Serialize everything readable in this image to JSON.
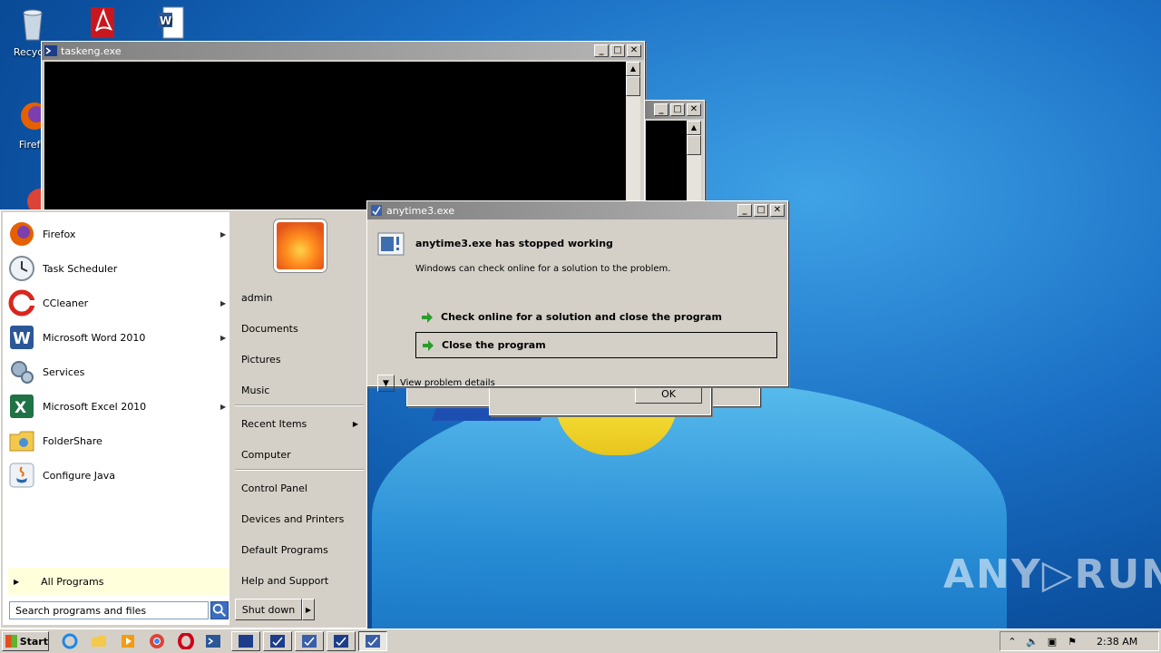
{
  "desktop": {
    "icons": [
      {
        "label": "Recycle"
      },
      {
        "label": "Firefo"
      }
    ]
  },
  "windows": {
    "taskeng": {
      "title": "taskeng.exe"
    },
    "error": {
      "title": "anytime3.exe",
      "heading": "anytime3.exe has stopped working",
      "subtext": "Windows can check online for a solution to the problem.",
      "option_check": "Check online for a solution and close the program",
      "option_close": "Close the program",
      "details": "View problem details"
    },
    "background_ok": "OK"
  },
  "start_menu": {
    "programs": [
      {
        "label": "Firefox",
        "submenu": true,
        "icon": "firefox-icon"
      },
      {
        "label": "Task Scheduler",
        "submenu": false,
        "icon": "clock-icon"
      },
      {
        "label": "CCleaner",
        "submenu": true,
        "icon": "ccleaner-icon"
      },
      {
        "label": "Microsoft Word 2010",
        "submenu": true,
        "icon": "word-icon"
      },
      {
        "label": "Services",
        "submenu": false,
        "icon": "gears-icon"
      },
      {
        "label": "Microsoft Excel 2010",
        "submenu": true,
        "icon": "excel-icon"
      },
      {
        "label": "FolderShare",
        "submenu": false,
        "icon": "folder-icon"
      },
      {
        "label": "Configure Java",
        "submenu": false,
        "icon": "java-icon"
      }
    ],
    "all_programs": "All Programs",
    "search_placeholder": "Search programs and files",
    "right": {
      "admin": "admin",
      "documents": "Documents",
      "pictures": "Pictures",
      "music": "Music",
      "recent_items": "Recent Items",
      "computer": "Computer",
      "control_panel": "Control Panel",
      "devices_printers": "Devices and Printers",
      "default_programs": "Default Programs",
      "help_support": "Help and Support"
    },
    "shutdown": "Shut down"
  },
  "taskbar": {
    "start": "Start",
    "clock": "2:38 AM"
  },
  "watermark": "ANY▷RUN"
}
